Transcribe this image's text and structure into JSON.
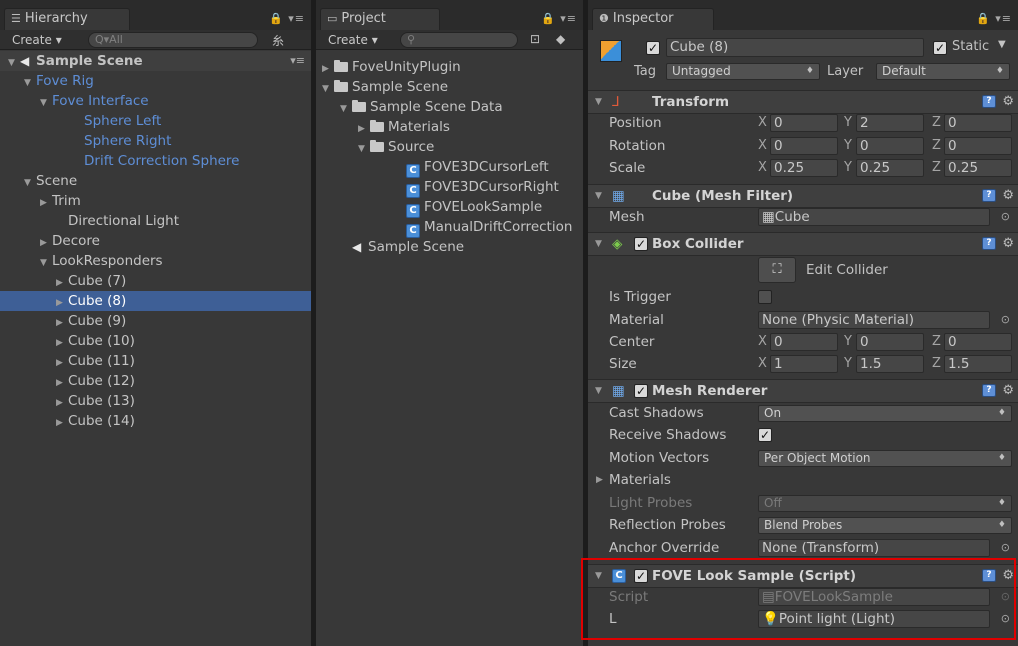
{
  "hierarchy": {
    "tab_label": "Hierarchy",
    "tab_controls": "🔒 ▾≡",
    "create_label": "Create ▾",
    "search_placeholder": "Q▾All",
    "scene_title": "Sample Scene",
    "rows": [
      {
        "label": "Fove Rig",
        "indent": 1,
        "arrow": "▼",
        "blue": true
      },
      {
        "label": "Fove Interface",
        "indent": 2,
        "arrow": "▼",
        "blue": true
      },
      {
        "label": "Sphere Left",
        "indent": 4,
        "arrow": "",
        "blue": true
      },
      {
        "label": "Sphere Right",
        "indent": 4,
        "arrow": "",
        "blue": true
      },
      {
        "label": "Drift Correction Sphere",
        "indent": 4,
        "arrow": "",
        "blue": true
      },
      {
        "label": "Scene",
        "indent": 1,
        "arrow": "▼",
        "blue": false
      },
      {
        "label": "Trim",
        "indent": 2,
        "arrow": "▶",
        "blue": false
      },
      {
        "label": "Directional Light",
        "indent": 3,
        "arrow": "",
        "blue": false
      },
      {
        "label": "Decore",
        "indent": 2,
        "arrow": "▶",
        "blue": false
      },
      {
        "label": "LookResponders",
        "indent": 2,
        "arrow": "▼",
        "blue": false
      },
      {
        "label": "Cube (7)",
        "indent": 3,
        "arrow": "▶",
        "blue": false
      },
      {
        "label": "Cube (8)",
        "indent": 3,
        "arrow": "▶",
        "blue": false,
        "selected": true
      },
      {
        "label": "Cube (9)",
        "indent": 3,
        "arrow": "▶",
        "blue": false
      },
      {
        "label": "Cube (10)",
        "indent": 3,
        "arrow": "▶",
        "blue": false
      },
      {
        "label": "Cube (11)",
        "indent": 3,
        "arrow": "▶",
        "blue": false
      },
      {
        "label": "Cube (12)",
        "indent": 3,
        "arrow": "▶",
        "blue": false
      },
      {
        "label": "Cube (13)",
        "indent": 3,
        "arrow": "▶",
        "blue": false
      },
      {
        "label": "Cube (14)",
        "indent": 3,
        "arrow": "▶",
        "blue": false
      }
    ]
  },
  "project": {
    "tab_label": "Project",
    "tab_controls": "🔒 ▾≡",
    "create_label": "Create ▾",
    "search_placeholder": "",
    "rows": [
      {
        "label": "FoveUnityPlugin",
        "indent": 0,
        "arrow": "▶",
        "icon": "folder"
      },
      {
        "label": "Sample Scene",
        "indent": 0,
        "arrow": "▼",
        "icon": "folder"
      },
      {
        "label": "Sample Scene Data",
        "indent": 1,
        "arrow": "▼",
        "icon": "folder"
      },
      {
        "label": "Materials",
        "indent": 2,
        "arrow": "▶",
        "icon": "folder"
      },
      {
        "label": "Source",
        "indent": 2,
        "arrow": "▼",
        "icon": "folder"
      },
      {
        "label": "FOVE3DCursorLeft",
        "indent": 4,
        "arrow": "",
        "icon": "cs"
      },
      {
        "label": "FOVE3DCursorRight",
        "indent": 4,
        "arrow": "",
        "icon": "cs"
      },
      {
        "label": "FOVELookSample",
        "indent": 4,
        "arrow": "",
        "icon": "cs"
      },
      {
        "label": "ManualDriftCorrection",
        "indent": 4,
        "arrow": "",
        "icon": "cs"
      },
      {
        "label": "Sample Scene",
        "indent": 1,
        "arrow": "",
        "icon": "unity"
      }
    ]
  },
  "inspector": {
    "tab_label": "Inspector",
    "tab_controls": "🔒 ▾≡",
    "object_name": "Cube (8)",
    "static_label": "Static",
    "tag_label": "Tag",
    "tag_value": "Untagged",
    "layer_label": "Layer",
    "layer_value": "Default",
    "transform": {
      "title": "Transform",
      "position_label": "Position",
      "position": {
        "x": "0",
        "y": "2",
        "z": "0"
      },
      "rotation_label": "Rotation",
      "rotation": {
        "x": "0",
        "y": "0",
        "z": "0"
      },
      "scale_label": "Scale",
      "scale": {
        "x": "0.25",
        "y": "0.25",
        "z": "0.25"
      }
    },
    "mesh_filter": {
      "title": "Cube (Mesh Filter)",
      "mesh_label": "Mesh",
      "mesh_value": "Cube"
    },
    "box_collider": {
      "title": "Box Collider",
      "edit_label": "Edit Collider",
      "is_trigger_label": "Is Trigger",
      "material_label": "Material",
      "material_value": "None (Physic Material)",
      "center_label": "Center",
      "center": {
        "x": "0",
        "y": "0",
        "z": "0"
      },
      "size_label": "Size",
      "size": {
        "x": "1",
        "y": "1.5",
        "z": "1.5"
      }
    },
    "mesh_renderer": {
      "title": "Mesh Renderer",
      "cast_shadows_label": "Cast Shadows",
      "cast_shadows_value": "On",
      "receive_shadows_label": "Receive Shadows",
      "motion_vectors_label": "Motion Vectors",
      "motion_vectors_value": "Per Object Motion",
      "materials_label": "Materials",
      "light_probes_label": "Light Probes",
      "light_probes_value": "Off",
      "reflection_probes_label": "Reflection Probes",
      "reflection_probes_value": "Blend Probes",
      "anchor_override_label": "Anchor Override",
      "anchor_override_value": "None (Transform)"
    },
    "fove_look_sample": {
      "title": "FOVE Look Sample (Script)",
      "script_label": "Script",
      "script_value": "FOVELookSample",
      "l_label": "L",
      "l_value": "Point light (Light)"
    },
    "highlight_color": "#e00000",
    "selection_color": "#3e5f96"
  }
}
